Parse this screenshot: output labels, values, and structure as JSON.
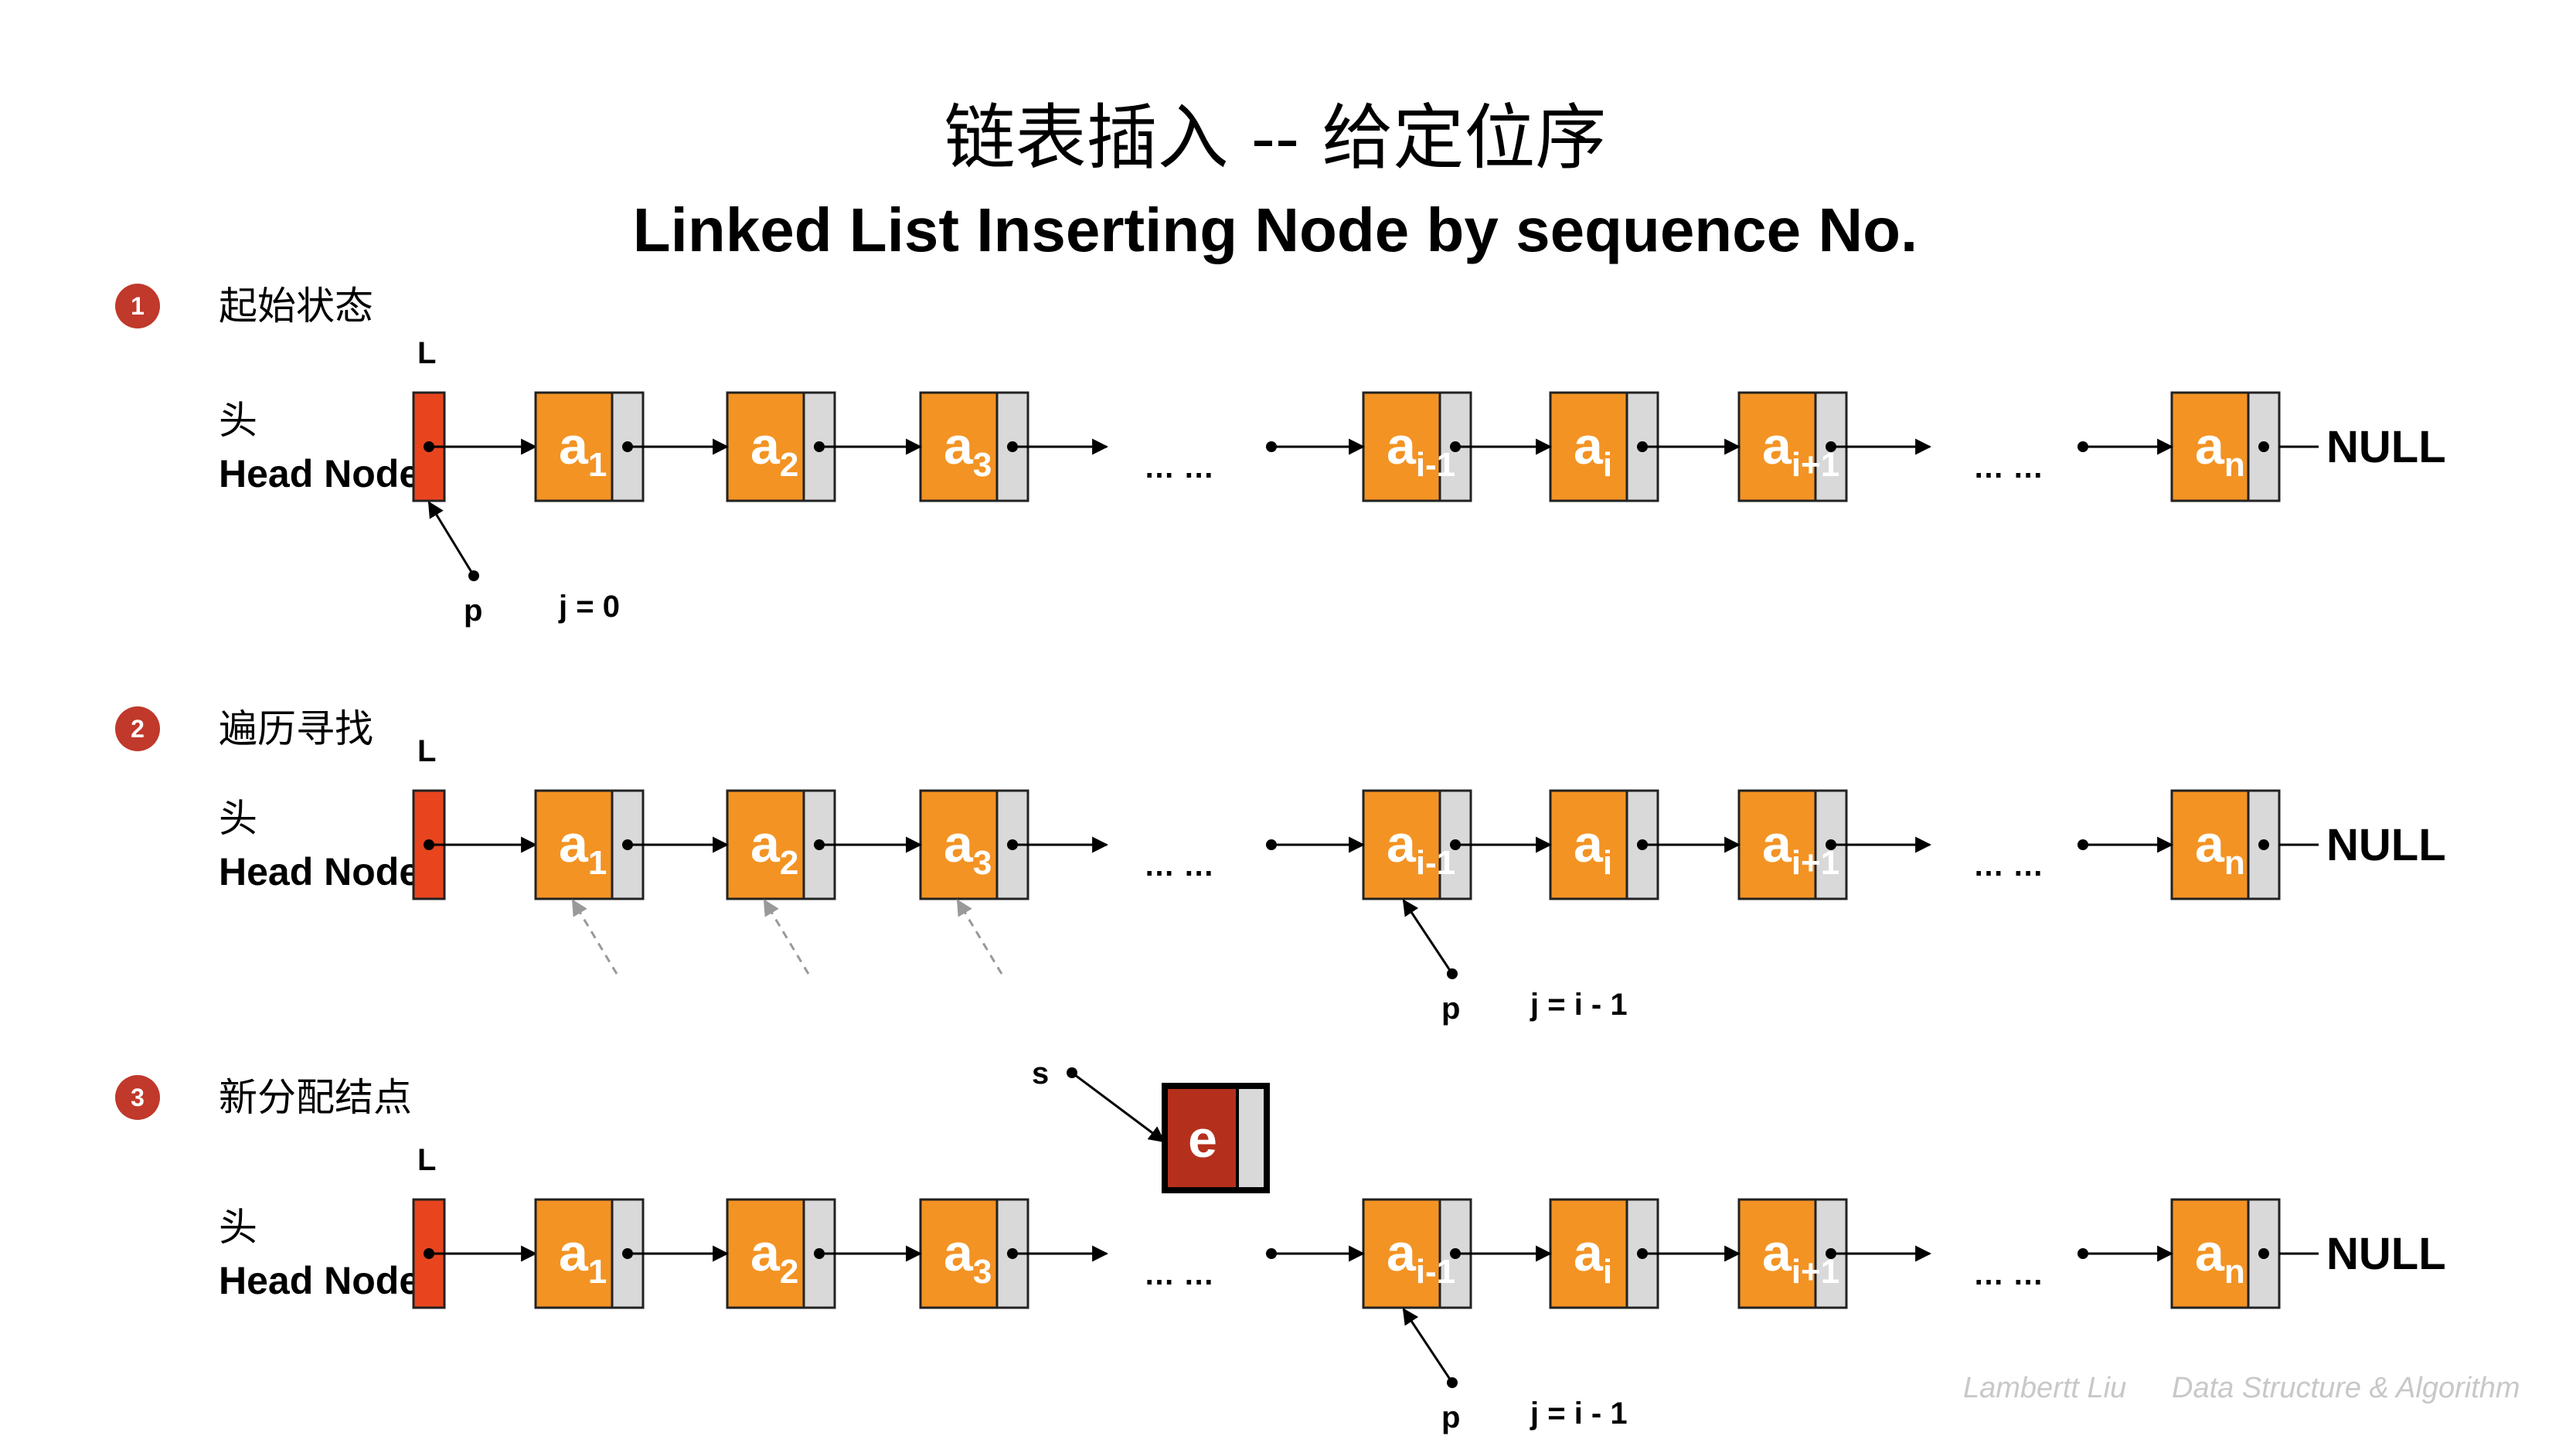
{
  "title_cn": "链表插入 -- 给定位序",
  "title_en": "Linked List Inserting Node by sequence No.",
  "colors": {
    "node_fill": "#F39323",
    "node_pointer_fill": "#D9D9D9",
    "head_fill": "#E8451F",
    "new_node_fill": "#B5301C",
    "badge_fill": "#C0392B",
    "footer_text": "#C8C8C8"
  },
  "node_labels": [
    {
      "base": "a",
      "sub": "1"
    },
    {
      "base": "a",
      "sub": "2"
    },
    {
      "base": "a",
      "sub": "3"
    },
    {
      "base": "a",
      "sub": "i-1"
    },
    {
      "base": "a",
      "sub": "i"
    },
    {
      "base": "a",
      "sub": "i+1"
    },
    {
      "base": "a",
      "sub": "n"
    }
  ],
  "ellipsis": "… …",
  "null_label": "NULL",
  "head_pointer_label": "L",
  "head_cn": "头",
  "head_en": "Head Node",
  "pointer_p_label": "p",
  "steps": [
    {
      "number": "1",
      "label": "起始状态",
      "counter": "j = 0"
    },
    {
      "number": "2",
      "label": "遍历寻找",
      "counter": "j = i - 1"
    },
    {
      "number": "3",
      "label": "新分配结点",
      "counter": "j = i - 1"
    }
  ],
  "new_node": {
    "label": "e",
    "pointer": "s"
  },
  "footer": {
    "author": "Lambertt Liu",
    "subject": "Data Structure & Algorithm"
  }
}
